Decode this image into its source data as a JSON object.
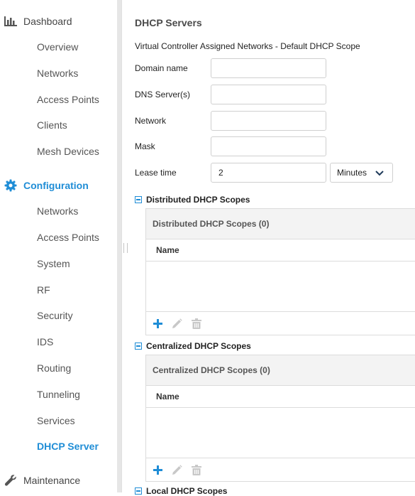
{
  "sidebar": {
    "dashboard": {
      "label": "Dashboard",
      "items": [
        "Overview",
        "Networks",
        "Access Points",
        "Clients",
        "Mesh Devices"
      ]
    },
    "configuration": {
      "label": "Configuration",
      "items": [
        "Networks",
        "Access Points",
        "System",
        "RF",
        "Security",
        "IDS",
        "Routing",
        "Tunneling",
        "Services",
        "DHCP Server"
      ],
      "active_item": "DHCP Server"
    },
    "maintenance": {
      "label": "Maintenance"
    }
  },
  "main": {
    "title": "DHCP Servers",
    "subtitle": "Virtual Controller Assigned Networks - Default DHCP Scope",
    "form": {
      "domain_name": {
        "label": "Domain name",
        "value": ""
      },
      "dns_servers": {
        "label": "DNS Server(s)",
        "value": ""
      },
      "network": {
        "label": "Network",
        "value": ""
      },
      "mask": {
        "label": "Mask",
        "value": ""
      },
      "lease_time": {
        "label": "Lease time",
        "value": "2",
        "unit": "Minutes"
      }
    },
    "distributed": {
      "header": "Distributed DHCP Scopes",
      "panel_title": "Distributed DHCP Scopes (0)",
      "column": "Name"
    },
    "centralized": {
      "header": "Centralized DHCP Scopes",
      "panel_title": "Centralized DHCP Scopes (0)",
      "column": "Name"
    },
    "local": {
      "header": "Local DHCP Scopes"
    }
  },
  "colors": {
    "accent": "#1f8dd6",
    "muted_icon": "#c8c8c8"
  },
  "icons": [
    "bar-chart-icon",
    "gear-icon",
    "wrench-icon",
    "plus-icon",
    "pencil-icon",
    "trash-icon",
    "chevron-down-icon",
    "collapse-icon"
  ]
}
